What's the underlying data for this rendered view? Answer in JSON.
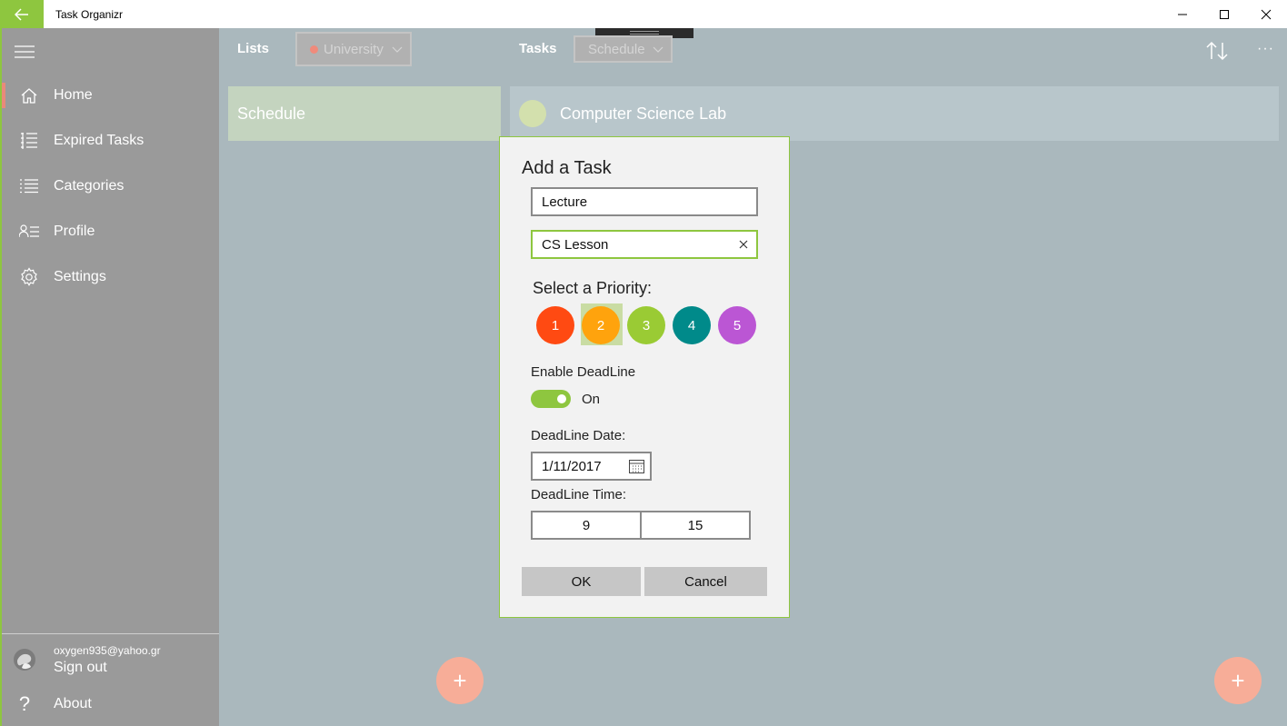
{
  "window": {
    "title": "Task Organizr"
  },
  "sidebar": {
    "items": [
      {
        "label": "Home",
        "icon": "home-icon"
      },
      {
        "label": "Expired Tasks",
        "icon": "expired-list-icon"
      },
      {
        "label": "Categories",
        "icon": "categories-icon"
      },
      {
        "label": "Profile",
        "icon": "profile-icon"
      },
      {
        "label": "Settings",
        "icon": "gear-icon"
      }
    ],
    "account": {
      "email": "oxygen935@yahoo.gr",
      "sign_out": "Sign out"
    },
    "about": {
      "icon_glyph": "?",
      "label": "About"
    }
  },
  "header": {
    "lists_label": "Lists",
    "lists_selected": "University",
    "tasks_label": "Tasks",
    "tasks_selected": "Schedule",
    "more_glyph": "···"
  },
  "lists": [
    {
      "name": "Schedule"
    }
  ],
  "tasks": [
    {
      "name": "Computer Science Lab"
    }
  ],
  "fab_glyph": "+",
  "dialog": {
    "title": "Add a Task",
    "name_value": "Lecture",
    "description_value": "CS Lesson",
    "priority_label": "Select a Priority:",
    "priorities": [
      {
        "label": "1",
        "color": "#ff4a12"
      },
      {
        "label": "2",
        "color": "#ffa30d"
      },
      {
        "label": "3",
        "color": "#9acb34"
      },
      {
        "label": "4",
        "color": "#008a8a"
      },
      {
        "label": "5",
        "color": "#bb56d4"
      }
    ],
    "selected_priority": "2",
    "deadline_toggle_label": "Enable DeadLine",
    "deadline_toggle_state": "On",
    "deadline_date_label": "DeadLine Date:",
    "deadline_date": "1/11/2017",
    "deadline_time_label": "DeadLine Time:",
    "deadline_hour": "9",
    "deadline_minute": "15",
    "ok_label": "OK",
    "cancel_label": "Cancel"
  },
  "colors": {
    "accent": "#8ec63f",
    "fab": "#f7ad98",
    "list_dot": "#f08a7b"
  }
}
